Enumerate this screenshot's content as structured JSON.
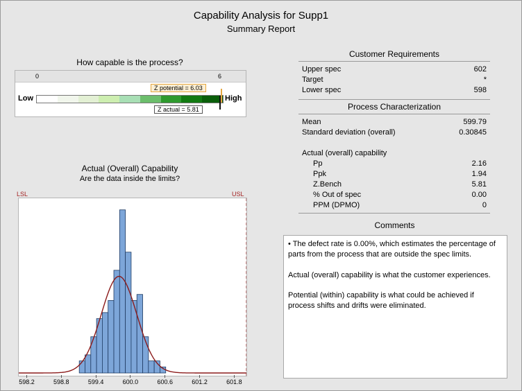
{
  "header": {
    "title": "Capability Analysis for Supp1",
    "subtitle": "Summary Report"
  },
  "gauge": {
    "title": "How capable is the process?",
    "scale_min": "0",
    "scale_max": "6",
    "low_label": "Low",
    "high_label": "High",
    "z_potential_label": "Z potential = 6.03",
    "z_actual_label": "Z actual = 5.81",
    "z_potential": 6.03,
    "z_actual": 5.81,
    "colors": [
      "#ffffff",
      "#f1f6ec",
      "#e3f0d4",
      "#cdeeb0",
      "#a8dfb5",
      "#6cbe6c",
      "#2e9a2e",
      "#127a12",
      "#0a5e0a"
    ]
  },
  "capability_chart": {
    "title": "Actual (Overall) Capability",
    "subtitle": "Are the data inside the limits?",
    "lsl_label": "LSL",
    "usl_label": "USL",
    "bar_color": "#7da6d9",
    "curve_color": "#8b1a1a",
    "limit_color": "#a32222"
  },
  "chart_data": {
    "type": "bar",
    "title": "Actual (Overall) Capability",
    "subtitle": "Are the data inside the limits?",
    "xlim": [
      598.05,
      602.0
    ],
    "ylim": [
      0,
      28
    ],
    "x_ticks": [
      "598.2",
      "598.8",
      "599.4",
      "600.0",
      "600.6",
      "601.2",
      "601.8"
    ],
    "x_tick_values": [
      598.2,
      598.8,
      599.4,
      600.0,
      600.6,
      601.2,
      601.8
    ],
    "lsl": 598,
    "usl": 602,
    "bin_width": 0.1,
    "bin_starts": [
      599.1,
      599.2,
      599.3,
      599.4,
      599.5,
      599.6,
      599.7,
      599.8,
      599.9,
      600.0,
      600.1,
      600.2,
      600.3,
      600.4,
      600.5
    ],
    "counts": [
      2,
      3,
      6,
      9,
      10,
      12,
      17,
      27,
      20,
      12,
      13,
      6,
      2,
      2,
      1
    ],
    "normal_fit": {
      "mean": 599.79,
      "sd": 0.30845,
      "peak": 16
    }
  },
  "customer_requirements": {
    "title": "Customer Requirements",
    "rows": [
      {
        "label": "Upper spec",
        "value": "602"
      },
      {
        "label": "Target",
        "value": "*"
      },
      {
        "label": "Lower spec",
        "value": "598"
      }
    ]
  },
  "process_characterization": {
    "title": "Process Characterization",
    "rows": [
      {
        "label": "Mean",
        "value": "599.79"
      },
      {
        "label": "Standard deviation (overall)",
        "value": "0.30845"
      }
    ],
    "capability_heading": "Actual (overall) capability",
    "capability_rows": [
      {
        "label": "Pp",
        "value": "2.16"
      },
      {
        "label": "Ppk",
        "value": "1.94"
      },
      {
        "label": "Z.Bench",
        "value": "5.81"
      },
      {
        "label": "% Out of spec",
        "value": "0.00"
      },
      {
        "label": "PPM (DPMO)",
        "value": "0"
      }
    ]
  },
  "comments": {
    "title": "Comments",
    "paragraphs": [
      "•  The defect rate is 0.00%, which estimates the percentage of parts from the process that are outside the spec limits.",
      "Actual (overall) capability is what the customer experiences.",
      "Potential (within) capability is what could be achieved if process shifts and drifts were eliminated."
    ]
  }
}
